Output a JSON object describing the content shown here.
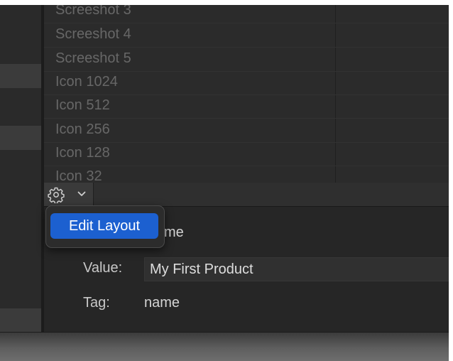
{
  "file_list": {
    "rows": [
      "Screeshot 3",
      "Screeshot 4",
      "Screeshot 5",
      "Icon 1024",
      "Icon 512",
      "Icon 256",
      "Icon 128",
      "Icon 32"
    ]
  },
  "toolbar": {
    "action_icon": "gear-icon",
    "dropdown_icon": "chevron-down-icon"
  },
  "popup_menu": {
    "items": [
      {
        "label": "Edit Layout",
        "highlighted": true
      }
    ]
  },
  "inspector": {
    "name_partial": "me",
    "value_label": "Value:",
    "value": "My First Product",
    "tag_label": "Tag:",
    "tag": "name"
  },
  "colors": {
    "menu_highlight": "#1c60d0",
    "background": "#262626"
  }
}
